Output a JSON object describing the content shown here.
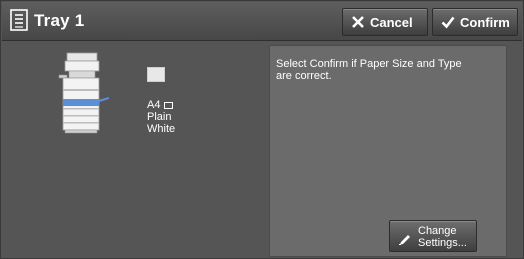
{
  "header": {
    "title": "Tray 1",
    "title_icon": "tray-list-icon",
    "cancel_label": "Cancel",
    "cancel_icon": "close-icon",
    "confirm_label": "Confirm",
    "confirm_icon": "check-icon"
  },
  "tray": {
    "paper_size": "A4",
    "orientation_icon": "paper-landscape-icon",
    "paper_type": "Plain",
    "paper_color": "White"
  },
  "panel": {
    "message": "Select Confirm if Paper Size and Type are correct.",
    "change_line1": "Change",
    "change_line2": "Settings...",
    "change_icon": "pen-icon"
  },
  "colors": {
    "background": "#555555",
    "panel": "#6b6b6b",
    "accent_tray": "#5b8fd6"
  }
}
